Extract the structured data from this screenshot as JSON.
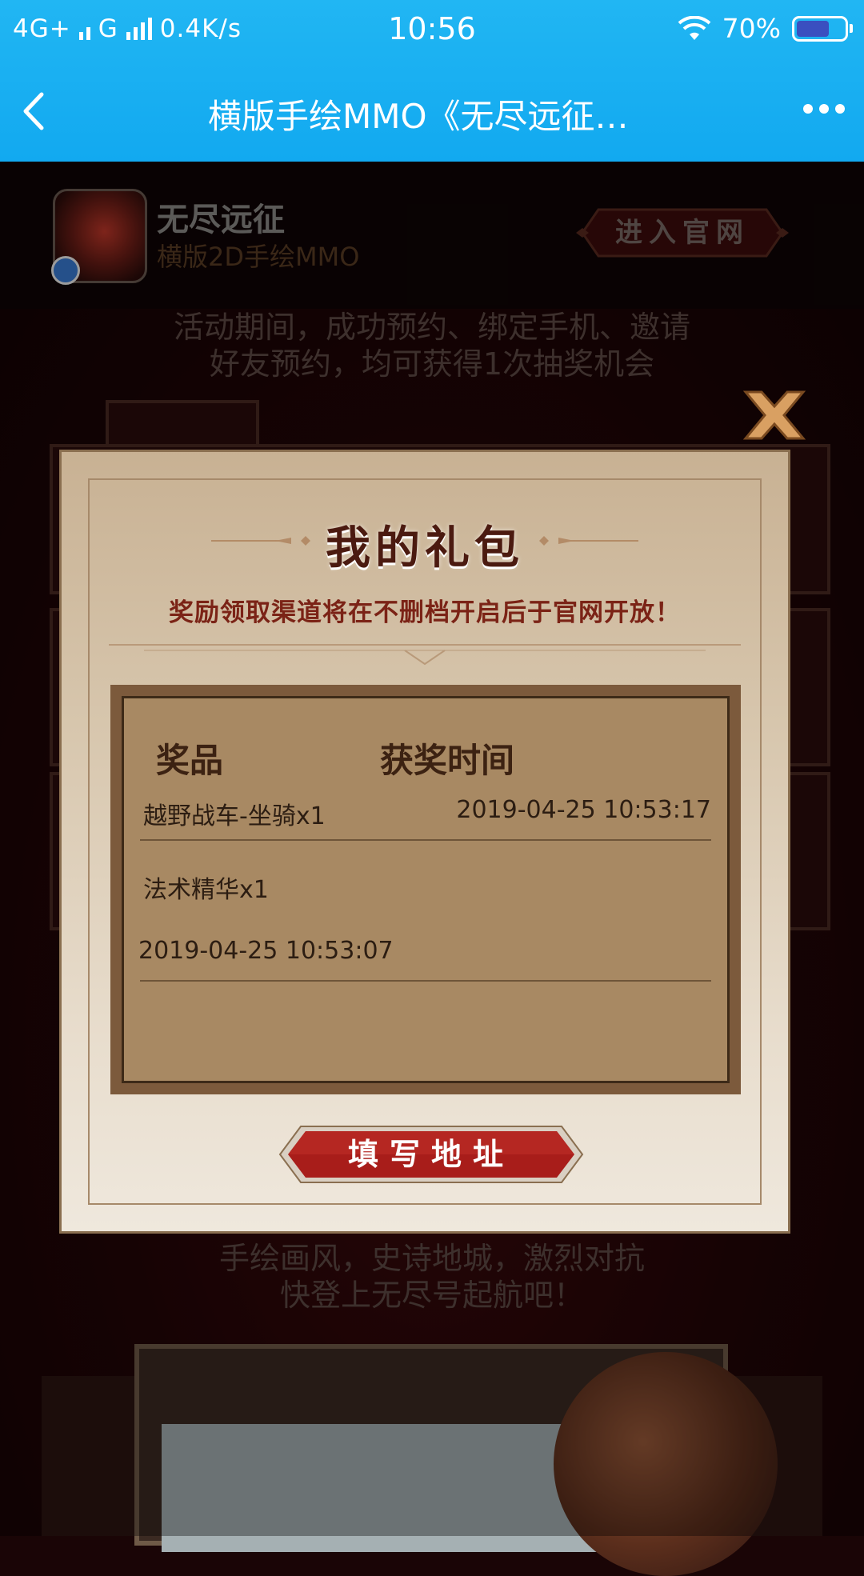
{
  "status_bar": {
    "network_left": "4G+",
    "network_mid": "G",
    "speed": "0.4K/s",
    "time": "10:56",
    "battery_percent": "70%",
    "battery_level": 0.7
  },
  "nav": {
    "title": "横版手绘MMO《无尽远征…",
    "back_icon": "chevron-left-icon",
    "more_icon": "more-dots-icon"
  },
  "game_header": {
    "name": "无尽远征",
    "subtitle": "横版2D手绘MMO",
    "enter_button": "进入官网"
  },
  "background_page": {
    "text_1_line1": "活动期间，成功预约、绑定手机、邀请",
    "text_1_line2": "好友预约，均可获得1次抽奖机会",
    "text_2_line1": "手绘画风，史诗地城，激烈对抗",
    "text_2_line2": "快登上无尽号起航吧！"
  },
  "modal": {
    "title": "我的礼包",
    "notice": "奖励领取渠道将在不删档开启后于官网开放！",
    "columns": [
      "奖品",
      "获奖时间"
    ],
    "rows": [
      {
        "prize": "越野战车-坐骑x1",
        "time": "2019-04-25 10:53:17"
      },
      {
        "prize": "法术精华x1",
        "time": "2019-04-25 10:53:07"
      }
    ],
    "address_button": "填写地址",
    "close_icon": "close-x-icon"
  },
  "colors": {
    "topbar": "#12a9f0",
    "modal_title": "#4b1a10",
    "button_red": "#a81d1a",
    "table_bg": "#a88963"
  }
}
